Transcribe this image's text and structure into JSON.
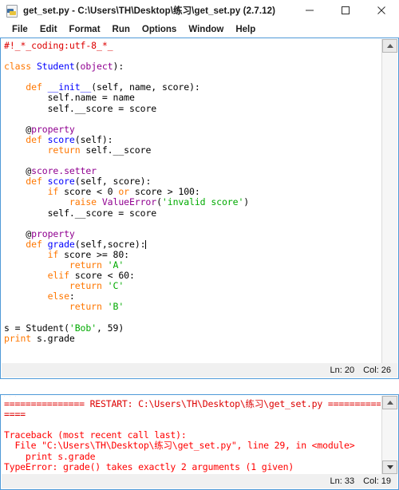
{
  "window": {
    "title": "get_set.py - C:\\Users\\TH\\Desktop\\练习\\get_set.py (2.7.12)",
    "icon": "python-file-icon",
    "controls": {
      "minimize": "minimize-button",
      "maximize": "maximize-button",
      "close": "close-button"
    }
  },
  "menubar": {
    "items": [
      {
        "label": "File"
      },
      {
        "label": "Edit"
      },
      {
        "label": "Format"
      },
      {
        "label": "Run"
      },
      {
        "label": "Options"
      },
      {
        "label": "Window"
      },
      {
        "label": "Help"
      }
    ]
  },
  "editor": {
    "status": {
      "line_label": "Ln: 20",
      "col_label": "Col: 26"
    },
    "code_lines": [
      "#!_*_coding:utf-8_*_",
      "",
      "class Student(object):",
      "",
      "    def __init__(self, name, score):",
      "        self.name = name",
      "        self.__score = score",
      "",
      "    @property",
      "    def score(self):",
      "        return self.__score",
      "",
      "    @score.setter",
      "    def score(self, score):",
      "        if score < 0 or score > 100:",
      "            raise ValueError('invalid score')",
      "        self.__score = score",
      "",
      "    @property",
      "    def grade(self,socre):",
      "        if score >= 80:",
      "            return 'A'",
      "        elif score < 60:",
      "            return 'C'",
      "        else:",
      "            return 'B'",
      "",
      "s = Student('Bob', 59)",
      "print s.grade"
    ]
  },
  "shell": {
    "status": {
      "line_label": "Ln: 33",
      "col_label": "Col: 19"
    },
    "lines": {
      "restart": "=============== RESTART: C:\\Users\\TH\\Desktop\\练习\\get_set.py ============",
      "restart_wrap": "====",
      "traceback_header": "Traceback (most recent call last):",
      "traceback_file": "  File \"C:\\Users\\TH\\Desktop\\练习\\get_set.py\", line 29, in <module>",
      "traceback_code": "    print s.grade",
      "error": "TypeError: grade() takes exactly 2 arguments (1 given)",
      "prompt": ">>>"
    }
  },
  "colors": {
    "comment": "#dd0000",
    "keyword": "#ff7700",
    "defname": "#0000ff",
    "builtin": "#900090",
    "string": "#00aa00",
    "error": "#ff0000",
    "window_border": "#4f9ad8"
  }
}
